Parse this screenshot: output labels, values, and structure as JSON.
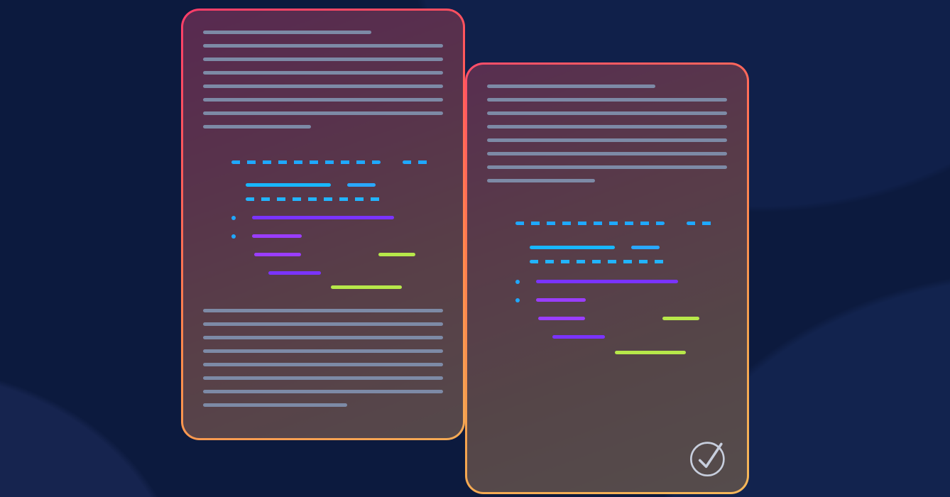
{
  "colors": {
    "background": "#0d1b3d",
    "card_fill": "rgba(24,35,70,0.72)",
    "text_line": "#7d8aa6",
    "code_cyan": "#18b7ff",
    "code_purple": "#7a33ff",
    "code_lime": "#b7e84a",
    "border_gradient_start": "#ff3d6a",
    "border_gradient_end": "#f5b85a",
    "check_stroke": "#c7cedd"
  },
  "left_card": {
    "top_text_lines": 8,
    "has_code_block": true,
    "bottom_text_lines": 8
  },
  "right_card": {
    "top_text_lines": 8,
    "has_code_block": true,
    "has_checkmark": true
  },
  "icons": {
    "checkmark": "verified-check-icon"
  }
}
